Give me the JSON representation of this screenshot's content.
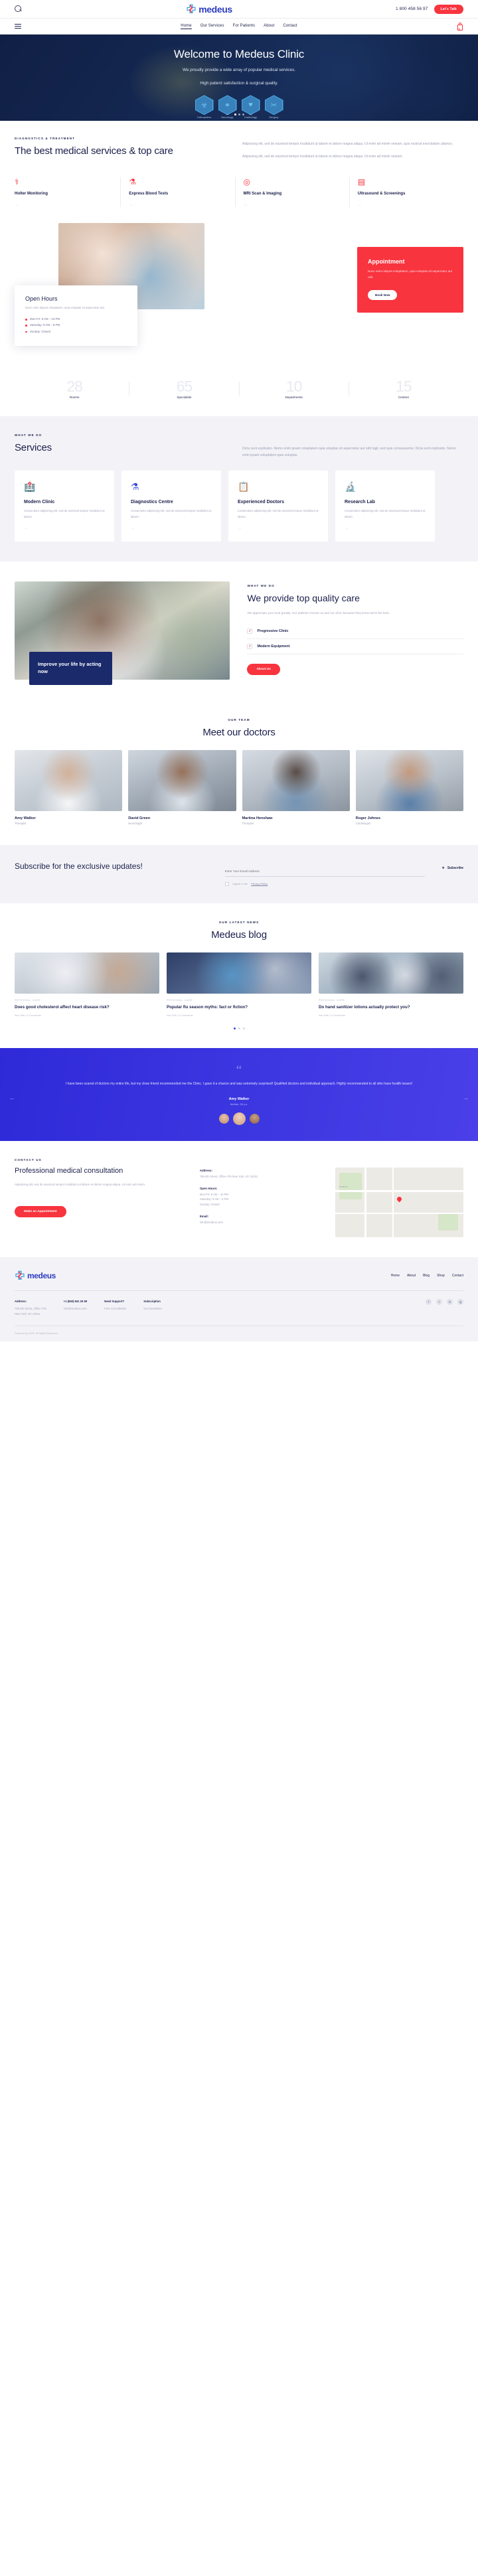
{
  "brand": {
    "name": "medeus",
    "accent": "#f8343f",
    "primary": "#2c3bbf",
    "dark": "#1b1f4b"
  },
  "topbar": {
    "search_icon": "search-icon",
    "phone": "1 800 458 56 97",
    "cta_label": "Let's Talk"
  },
  "nav": {
    "items": [
      {
        "label": "Home",
        "active": true
      },
      {
        "label": "Our Services",
        "active": false
      },
      {
        "label": "For Patients",
        "active": false
      },
      {
        "label": "About",
        "active": false
      },
      {
        "label": "Contact",
        "active": false
      }
    ],
    "cart_count": "0"
  },
  "hero": {
    "title": "Welcome to Medeus Clinic",
    "line1": "We proudly provide a wide array of popular medical services.",
    "line2": "High patient satisfaction & surgical quality.",
    "hexes": [
      {
        "icon": "bone-icon",
        "glyph": "☳",
        "label": "Orthopedics"
      },
      {
        "icon": "brain-icon",
        "glyph": "⚡",
        "label": "Neurology"
      },
      {
        "icon": "heart-icon",
        "glyph": "♥",
        "label": "Cardiology"
      },
      {
        "icon": "scalpel-icon",
        "glyph": "✂",
        "label": "Surgery"
      }
    ],
    "prev": "←",
    "next": "→"
  },
  "diagnostics": {
    "eyebrow": "DIAGNOSTICS & TREATMENT",
    "title": "The best medical services & top care",
    "para1": "Adipiscing elit, sed do eiusmod tempor incididunt ut labore et dolore magna aliqua. Ut enim ad minim veniam, quis nostrud exercitation ullamco.",
    "para2": "Adipiscing elit, sed do eiusmod tempor incididunt ut labore et dolore magna aliqua. Ut enim ad minim veniam.",
    "cards": [
      {
        "icon": "holter-icon",
        "glyph": "⚕",
        "title": "Holter Monitoring",
        "arrow": "→"
      },
      {
        "icon": "blood-test-icon",
        "glyph": "⚗",
        "title": "Express Blood Tests",
        "arrow": "→"
      },
      {
        "icon": "mri-icon",
        "glyph": "◎",
        "title": "MRI Scan & Imaging",
        "arrow": "→"
      },
      {
        "icon": "ultrasound-icon",
        "glyph": "▤",
        "title": "Ultrasound & Screenings",
        "arrow": "→"
      }
    ]
  },
  "appointment": {
    "title": "Appointment",
    "text": "Nunc enim aliquet voluptatem, quia voluptas sit aspernatur aut odit.",
    "button": "Book Now"
  },
  "hours": {
    "title": "Open Hours",
    "sub": "Nunc enim aliquet voluptatem, quia voluptas sit aspernatur aut.",
    "rows": [
      "Mon-Fri: 8 AM – 10 PM",
      "Saturday: 9 AM – 8 PM",
      "Sunday: Closed"
    ]
  },
  "stats": [
    {
      "num": "28",
      "label": "Rooms"
    },
    {
      "num": "65",
      "label": "Specialists"
    },
    {
      "num": "10",
      "label": "Departments"
    },
    {
      "num": "15",
      "label": "Centres"
    }
  ],
  "services": {
    "eyebrow": "WHAT WE DO",
    "title": "Services",
    "desc": "Dicta sunt explicabo. Nemo enim ipsam voluptatem quia voluptas sit aspernatur aut odit fugit, sed quia consequuntur. Dicta sunt explicabo. Nemo enim ipsam voluptatem quia voluptas.",
    "cards": [
      {
        "icon": "clinic-icon",
        "glyph": "Ἶ5",
        "title": "Modern Clinic",
        "text": "Consectetur adipiscing elit, sed do eiusmod tempor incididunt ut labore.",
        "arrow": "→"
      },
      {
        "icon": "diagnostics-icon",
        "glyph": "⚗",
        "title": "Diagnostics Centre",
        "text": "Consectetur adipiscing elit, sed do eiusmod tempor incididunt ut labore.",
        "arrow": "→"
      },
      {
        "icon": "doctor-icon",
        "glyph": "ὌB",
        "title": "Experienced Doctors",
        "text": "Consectetur adipiscing elit, sed do eiusmod tempor incididunt ut labore.",
        "arrow": "→"
      },
      {
        "icon": "research-icon",
        "glyph": "ὒC",
        "title": "Research Lab",
        "text": "Consectetur adipiscing elit, sed do eiusmod tempor incididunt ut labore.",
        "arrow": "→"
      }
    ]
  },
  "quality": {
    "badge": "Improve your life by acting now",
    "eyebrow": "WHAT WE DO",
    "title": "We provide top quality care",
    "desc": "We appreciate your trust greatly. Our patients choose us and our clinic because they know we're the best.",
    "checks": [
      {
        "label": "Progressive Clinic",
        "mark": "✓"
      },
      {
        "label": "Modern Equipment",
        "mark": "✓"
      }
    ],
    "button": "About Us",
    "button_arrow": "→"
  },
  "team": {
    "eyebrow": "OUR TEAM",
    "title": "Meet our doctors",
    "doctors": [
      {
        "name": "Amy Walker",
        "role": "Therapist"
      },
      {
        "name": "David Green",
        "role": "Neurologist"
      },
      {
        "name": "Martina Henshaw",
        "role": "Therapist"
      },
      {
        "name": "Roger Johnes",
        "role": "Cardiologist"
      }
    ]
  },
  "subscribe": {
    "title": "Subscribe for the exclusive updates!",
    "input_placeholder": "Enter Your Email Address",
    "agree_prefix": "I agree to the",
    "agree_link": "Privacy Policy",
    "button": "Subscribe",
    "button_icon": "send-icon"
  },
  "blog": {
    "eyebrow": "OUR LATEST NEWS",
    "title": "Medeus blog",
    "posts": [
      {
        "meta": "PERSONAL CARE",
        "title": "Does good cholesterol affect heart disease risk?",
        "date": "Nov 15th | 0 Comments"
      },
      {
        "meta": "PERSONAL CARE",
        "title": "Popular flu season myths: fact or fiction?",
        "date": "Nov 11th | 0 Comments"
      },
      {
        "meta": "PERSONAL CARE",
        "title": "Do hand sanitizer lotions actually protect you?",
        "date": "Nov 04th | 0 Comments"
      }
    ],
    "dots": [
      true,
      false,
      false
    ]
  },
  "testimonial": {
    "quote_mark": "“",
    "text": "I have been scared of doctors my entire life, but my close friend recommended me the Clinic. I gave it a chance and was extremely surprised! Qualified doctors and individual approach. Highly recommended to all who have health issues!",
    "name": "Amy Walker",
    "role": "Mother, 39 y.o.",
    "prev": "←",
    "next": "→"
  },
  "contact": {
    "eyebrow": "CONTACT US",
    "title": "Professional medical consultation",
    "desc": "Adipiscing elit, sed do eiusmod tempor incididunt ut labore et dolore magna aliqua. Ut enim ad minim.",
    "button": "Make an Appointment",
    "items": [
      {
        "key": "Address:",
        "value": "786 5th Street, Office #78 New York, NY 10012"
      },
      {
        "key": "Open Hours:",
        "value": "Mon-Fri: 8 AM – 10 PM\nSaturday: 9 AM – 8 PM\nSunday: Closed"
      },
      {
        "key": "Email:",
        "value": "info@medeus.com"
      }
    ],
    "map_label": "W 50th St"
  },
  "footer": {
    "nav": [
      "Home",
      "About",
      "Blog",
      "Shop",
      "Contact"
    ],
    "address_title": "Address:",
    "address": "786 5th Street, Office #78\nNew York, NY 10012",
    "phone_title": "+1 (840) 841 25 69",
    "email": "info@medeus.com",
    "help_title": "Need Support?",
    "help_text": "Free Consultation",
    "help2_title": "Subscription",
    "help2_text": "Our Newsletter",
    "socials": [
      "f",
      "t",
      "in",
      "ig"
    ],
    "copyright": "Powered by 2025. All Rights Reserved."
  }
}
